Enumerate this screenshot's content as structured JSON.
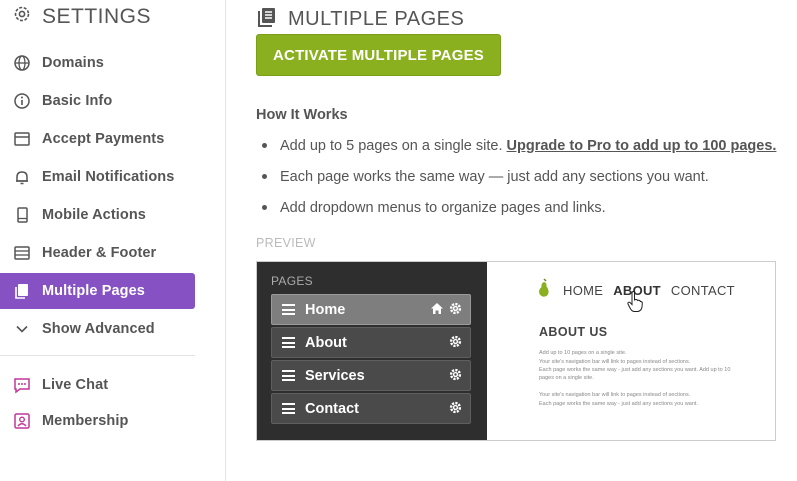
{
  "sidebar": {
    "title": "SETTINGS",
    "items": [
      {
        "label": "Domains",
        "icon": "globe-icon"
      },
      {
        "label": "Basic Info",
        "icon": "info-icon"
      },
      {
        "label": "Accept Payments",
        "icon": "credit-card-icon"
      },
      {
        "label": "Email Notifications",
        "icon": "bell-icon"
      },
      {
        "label": "Mobile Actions",
        "icon": "mobile-icon"
      },
      {
        "label": "Header & Footer",
        "icon": "header-footer-icon"
      },
      {
        "label": "Multiple Pages",
        "icon": "pages-icon",
        "active": true
      },
      {
        "label": "Show Advanced",
        "icon": "chevron-down-icon"
      }
    ],
    "extras": [
      {
        "label": "Live Chat",
        "icon": "chat-icon"
      },
      {
        "label": "Membership",
        "icon": "member-icon"
      }
    ]
  },
  "main": {
    "title": "MULTIPLE PAGES",
    "activate_label": "ACTIVATE MULTIPLE PAGES",
    "how_title": "How It Works",
    "bullets": {
      "b1_text": "Add up to 5 pages on a single site.",
      "b1_link": "Upgrade to Pro to add up to 100 pages.",
      "b2": "Each page works the same way — just add any sections you want.",
      "b3": "Add dropdown menus to organize pages and links."
    },
    "preview_label": "PREVIEW"
  },
  "preview": {
    "pages_label": "PAGES",
    "pages": [
      "Home",
      "About",
      "Services",
      "Contact"
    ],
    "nav": [
      "HOME",
      "ABOUT",
      "CONTACT"
    ],
    "about_title": "ABOUT US",
    "text1": "Add up to 10 pages on a single site.",
    "text2": "Your site's navigation bar will link to pages instead of sections.",
    "text3": "Each page works the same way - just add any sections you want. Add up to 10 pages on a single site.",
    "text4": "Your site's navigation bar will link to pages instead of sections.",
    "text5": "Each page works the same way - just add any sections you want."
  },
  "colors": {
    "accent_purple": "#8651c2",
    "button_green": "#8ab020",
    "preview_dark": "#2e2e2e",
    "pear_green": "#8ab020"
  }
}
